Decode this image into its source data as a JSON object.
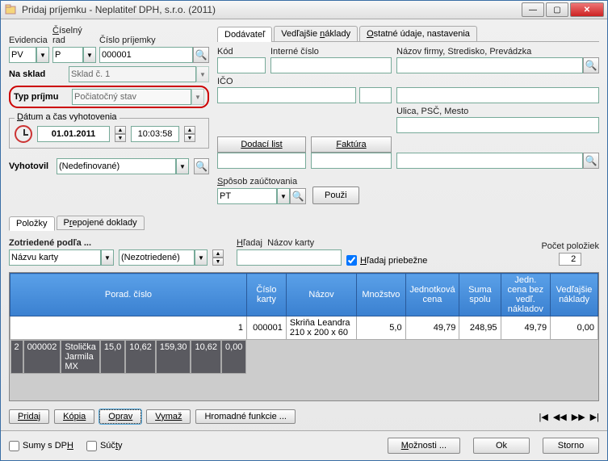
{
  "window": {
    "title": "Pridaj príjemku - Neplatiteľ DPH, s.r.o. (2011)"
  },
  "labels": {
    "evidencia": "Evidencia",
    "ciselny_rad": "Číselný rad",
    "cislo_prijemky": "Číslo príjemky",
    "na_sklad": "Na sklad",
    "typ_prijmu": "Typ príjmu",
    "datum_cas": "Dátum a čas vyhotovenia",
    "vyhotovil": "Vyhotovil",
    "sposob_zauct": "Spôsob zaúčtovania",
    "pouzi": "Použi",
    "dodavatel": "Dodávateľ",
    "vedlajsie_naklady": "Vedľajšie náklady",
    "ostatne": "Ostatné údaje, nastavenia",
    "kod": "Kód",
    "interne_cislo": "Interné číslo",
    "nazov_firmy": "Názov firmy, Stredisko, Prevádzka",
    "ico": "IČO",
    "ulica": "Ulica, PSČ, Mesto",
    "dodaci_list": "Dodací list",
    "faktura": "Faktúra",
    "polozky": "Položky",
    "prepojene": "Prepojené doklady",
    "zotriedene": "Zotriedené podľa ...",
    "hladaj": "Hľadaj",
    "nazov_karty": "Názov karty",
    "hladaj_priebezne": "Hľadaj priebežne",
    "pocet_poloziek": "Počet položiek",
    "pridaj": "Pridaj",
    "kopia": "Kópia",
    "oprav": "Oprav",
    "vymaz": "Vymaž",
    "hromadne": "Hromadné funkcie ...",
    "sumy_dph": "Sumy s DPH",
    "sucty": "Súčty",
    "moznosti": "Možnosti ...",
    "ok": "Ok",
    "storno": "Storno"
  },
  "values": {
    "evidencia": "PV",
    "ciselny_rad": "P",
    "cislo_prijemky": "000001",
    "na_sklad": "Sklad č. 1",
    "typ_prijmu": "Počiatočný stav",
    "datum": "01.01.2011",
    "cas": "10:03:58",
    "vyhotovil": "(Nedefinované)",
    "sposob_zauct": "PT",
    "sort1": "Názvu karty",
    "sort2": "(Nezotriedené)",
    "pocet": "2",
    "search": ""
  },
  "columns": {
    "porad": "Porad. číslo",
    "cislo_karty": "Číslo karty",
    "nazov": "Názov",
    "mnozstvo": "Množstvo",
    "jedn_cena": "Jednotková cena",
    "suma_spolu": "Suma spolu",
    "jedn_bez": "Jedn. cena bez vedľ. nákladov",
    "vedl_nakl": "Vedľajšie náklady"
  },
  "rows": [
    {
      "porad": "1",
      "cislo": "000001",
      "nazov": "Skriňa Leandra 210 x 200 x 60",
      "mnoz": "5,0",
      "jcena": "49,79",
      "suma": "248,95",
      "jbez": "49,79",
      "vedl": "0,00"
    },
    {
      "porad": "2",
      "cislo": "000002",
      "nazov": "Stolička Jarmila MX",
      "mnoz": "15,0",
      "jcena": "10,62",
      "suma": "159,30",
      "jbez": "10,62",
      "vedl": "0,00"
    }
  ]
}
